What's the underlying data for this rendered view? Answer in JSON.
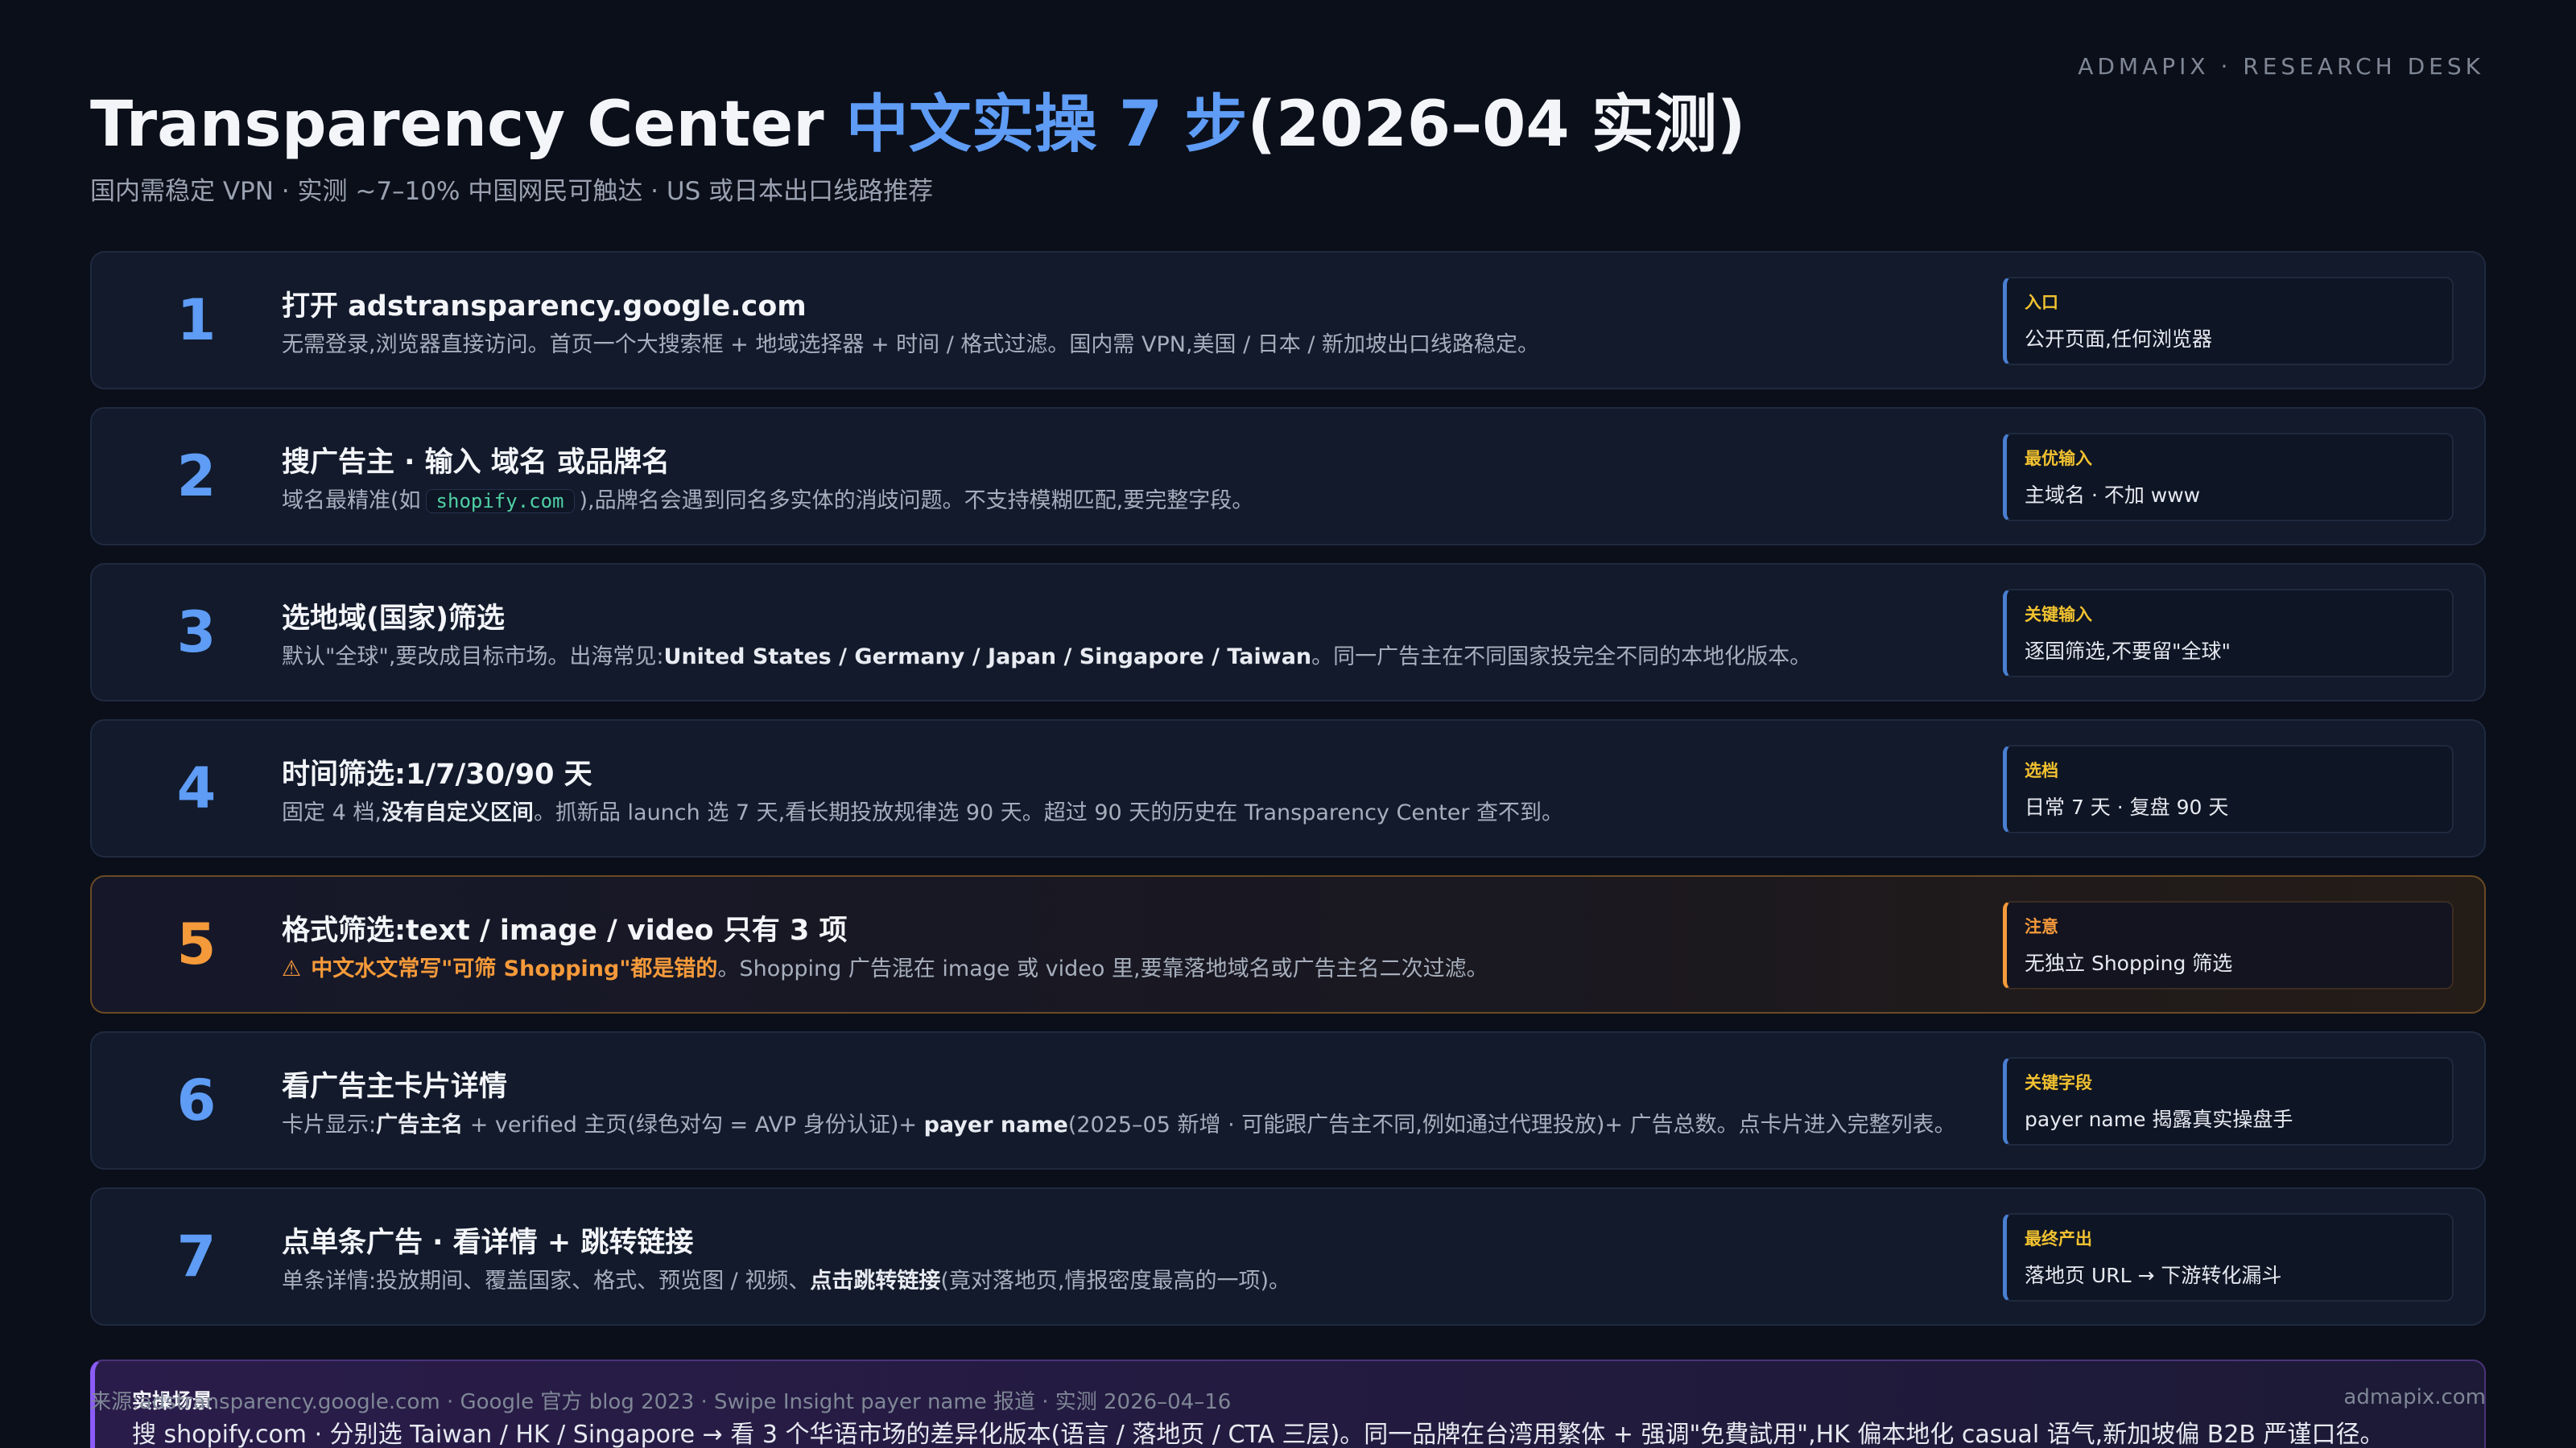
{
  "header": {
    "brand": "ADMAPIX · RESEARCH DESK",
    "title_main": "Transparency Center ",
    "title_accent": "中文实操 7 步",
    "title_tail": "(2026–04 实测)",
    "subtitle": "国内需稳定 VPN · 实测 ~7–10% 中国网民可触达 · US 或日本出口线路推荐"
  },
  "steps": [
    {
      "num": "1",
      "title": "打开 adstransparency.google.com",
      "desc": "无需登录,浏览器直接访问。首页一个大搜索框 + 地域选择器 + 时间 / 格式过滤。国内需 VPN,美国 / 日本 / 新加坡出口线路稳定。",
      "tag_label": "入口",
      "tag_value": "公开页面,任何浏览器"
    },
    {
      "num": "2",
      "title": "搜广告主 · 输入 域名 或品牌名",
      "desc_pre": "域名最精准(如",
      "desc_code": "shopify.com",
      "desc_post": "),品牌名会遇到同名多实体的消歧问题。不支持模糊匹配,要完整字段。",
      "tag_label": "最优输入",
      "tag_value": "主域名 · 不加 www"
    },
    {
      "num": "3",
      "title": "选地域(国家)筛选",
      "desc_pre": "默认\"全球\",要改成目标市场。出海常见:",
      "desc_bold": "United States / Germany / Japan / Singapore / Taiwan",
      "desc_post": "。同一广告主在不同国家投完全不同的本地化版本。",
      "tag_label": "关键输入",
      "tag_value": "逐国筛选,不要留\"全球\""
    },
    {
      "num": "4",
      "title": "时间筛选:1/7/30/90 天",
      "desc_pre": "固定 4 档,",
      "desc_bold": "没有自定义区间",
      "desc_post": "。抓新品 launch 选 7 天,看长期投放规律选 90 天。超过 90 天的历史在 Transparency Center 查不到。",
      "tag_label": "选档",
      "tag_value": "日常 7 天 · 复盘 90 天"
    },
    {
      "num": "5",
      "title": "格式筛选:text / image / video 只有 3 项",
      "warn_icon": "⚠",
      "desc_warn": "中文水文常写\"可筛 Shopping\"都是错的",
      "desc_post": "。Shopping 广告混在 image 或 video 里,要靠落地域名或广告主名二次过滤。",
      "tag_label": "注意",
      "tag_value": "无独立 Shopping 筛选"
    },
    {
      "num": "6",
      "title": "看广告主卡片详情",
      "desc_pre": "卡片显示:",
      "desc_bold": "广告主名",
      "desc_mid": " + verified 主页(绿色对勾 = AVP 身份认证)+ ",
      "desc_bold2": "payer name",
      "desc_post": "(2025–05 新增 · 可能跟广告主不同,例如通过代理投放)+ 广告总数。点卡片进入完整列表。",
      "tag_label": "关键字段",
      "tag_value": "payer name 揭露真实操盘手"
    },
    {
      "num": "7",
      "title": "点单条广告 · 看详情 + 跳转链接",
      "desc_pre": "单条详情:投放期间、覆盖国家、格式、预览图 / 视频、",
      "desc_bold": "点击跳转链接",
      "desc_post": "(竟对落地页,情报密度最高的一项)。",
      "tag_label": "最终产出",
      "tag_value": "落地页 URL → 下游转化漏斗"
    }
  ],
  "scene": {
    "label": "实操场景",
    "text": "搜 shopify.com · 分别选 Taiwan / HK / Singapore → 看 3 个华语市场的差异化版本(语言 / 落地页 / CTA 三层)。同一品牌在台湾用繁体 + 强调\"免費試用\",HK 偏本地化 casual 语气,新加坡偏 B2B 严谨口径。"
  },
  "footer": {
    "source": "来源:adstransparency.google.com · Google 官方 blog 2023 · Swipe Insight payer name 报道 · 实测 2026–04–16",
    "site": "admapix.com"
  },
  "colors": {
    "background": "#0b0f1a",
    "accent_blue": "#5e9cf5",
    "accent_orange": "#f59a3a",
    "tag_label_yellow": "#f2c230",
    "scene_purple": "#8b5cf6",
    "code_green": "#4fd1a5"
  }
}
